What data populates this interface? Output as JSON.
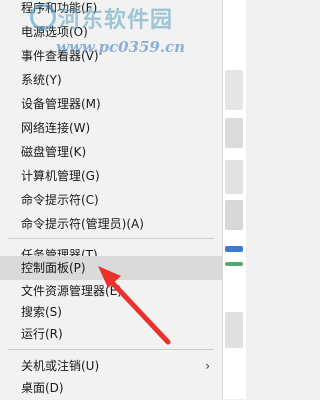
{
  "menu": {
    "items": [
      {
        "label": "程序和功能(F)"
      },
      {
        "label": "电源选项(O)"
      },
      {
        "label": "事件查看器(V)"
      },
      {
        "label": "系统(Y)"
      },
      {
        "label": "设备管理器(M)"
      },
      {
        "label": "网络连接(W)"
      },
      {
        "label": "磁盘管理(K)"
      },
      {
        "label": "计算机管理(G)"
      },
      {
        "label": "命令提示符(C)"
      },
      {
        "label": "命令提示符(管理员)(A)"
      },
      {
        "label": "任务管理器(T)"
      },
      {
        "label": "控制面板(P)"
      },
      {
        "label": "文件资源管理器(E)"
      },
      {
        "label": "搜索(S)"
      },
      {
        "label": "运行(R)"
      },
      {
        "label": "关机或注销(U)"
      },
      {
        "label": "桌面(D)"
      }
    ],
    "selected_index": 11,
    "submenu_chevron": "›"
  },
  "watermark": {
    "title": "河东软件园",
    "url": "www.pc0359.cn"
  },
  "annotation": {
    "arrow_color": "#e8322b"
  }
}
